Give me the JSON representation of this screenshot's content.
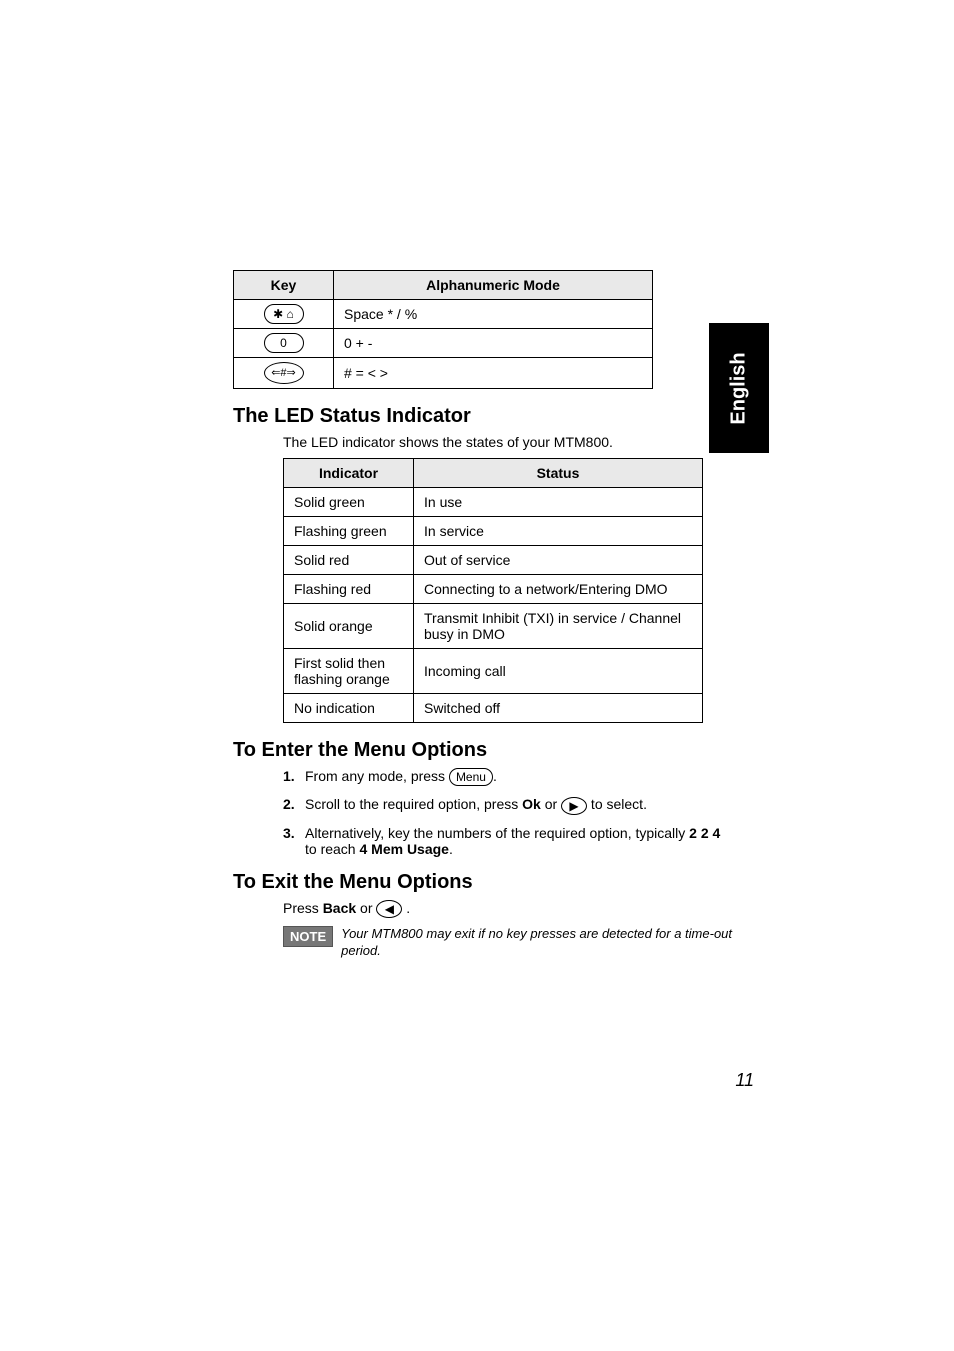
{
  "side_tab": {
    "label": "English"
  },
  "key_table": {
    "headers": {
      "key": "Key",
      "mode": "Alphanumeric Mode"
    },
    "rows": [
      {
        "key_glyph": "✱ ⌂",
        "mode": "Space   *   /   %"
      },
      {
        "key_glyph": "0",
        "mode": "0  +   -"
      },
      {
        "key_glyph": "⇐#⇒",
        "mode": "#   =   <   >"
      }
    ]
  },
  "sections": {
    "led": {
      "heading": "The LED Status Indicator",
      "intro": "The LED indicator shows the states of your MTM800."
    },
    "enter_menu": {
      "heading": "To Enter the Menu Options"
    },
    "exit_menu": {
      "heading": "To Exit the Menu Options"
    }
  },
  "indicator_table": {
    "headers": {
      "indicator": "Indicator",
      "status": "Status"
    },
    "rows": [
      {
        "indicator": "Solid green",
        "status": "In use"
      },
      {
        "indicator": "Flashing green",
        "status": "In service"
      },
      {
        "indicator": "Solid red",
        "status": "Out of service"
      },
      {
        "indicator": "Flashing red",
        "status": "Connecting to a network/Entering DMO"
      },
      {
        "indicator": "Solid orange",
        "status": "Transmit Inhibit (TXI) in service / Channel busy in DMO"
      },
      {
        "indicator": "First solid then flashing orange",
        "status": "Incoming call"
      },
      {
        "indicator": "No indication",
        "status": "Switched off"
      }
    ]
  },
  "steps": {
    "s1_a": "From any mode, press ",
    "s1_key": "Menu",
    "s1_b": ".",
    "s2_a": "Scroll to the required option, press ",
    "s2_ok": "Ok",
    "s2_b": " or ",
    "s2_arrow": "▶",
    "s2_c": " to select.",
    "s3_a": "Alternatively, key the numbers of the required option, typically ",
    "s3_bold1": "2 2 4",
    "s3_b": " to reach ",
    "s3_bold2": "4 Mem Usage",
    "s3_c": "."
  },
  "exit": {
    "press": "Press ",
    "back": "Back",
    "or": " or ",
    "arrow": "◀",
    "dot": " ."
  },
  "note": {
    "label": "NOTE",
    "text": "Your MTM800 may exit if no key presses are detected for a time-out period."
  },
  "page_number": "11",
  "nums": {
    "n1": "1.",
    "n2": "2.",
    "n3": "3."
  }
}
